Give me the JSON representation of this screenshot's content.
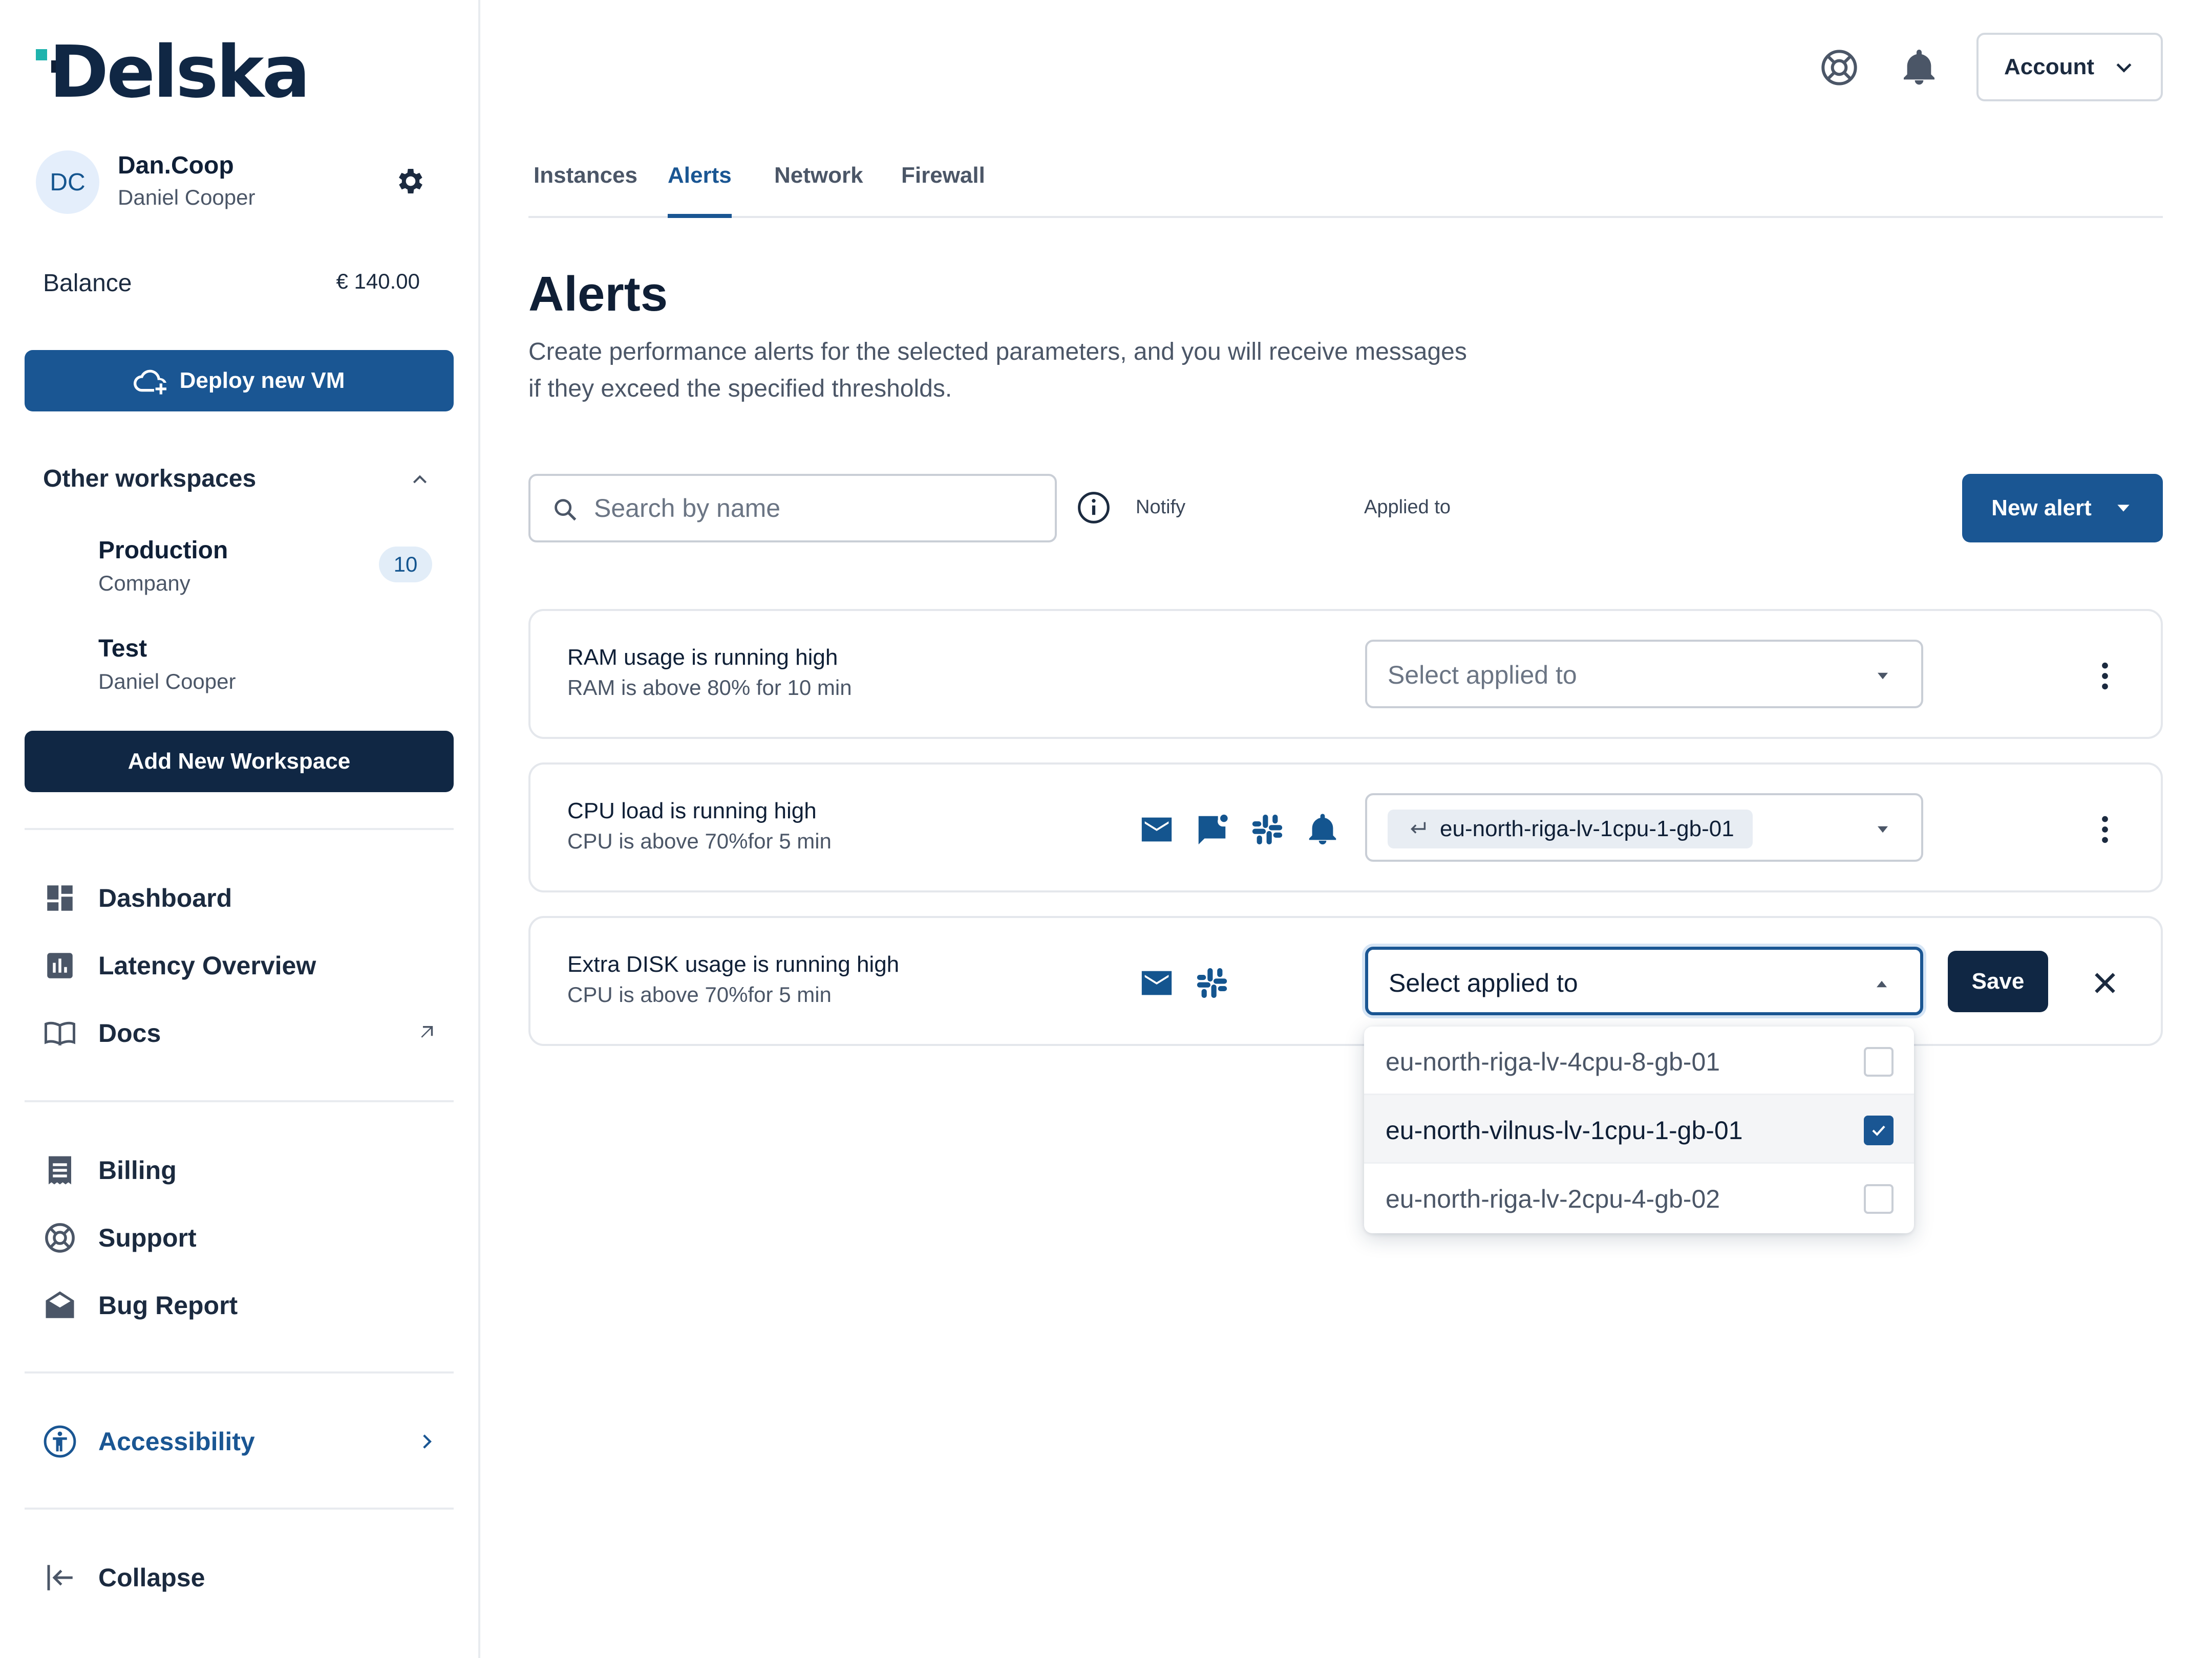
{
  "app": {
    "logo_text": "Delska"
  },
  "user": {
    "initials": "DC",
    "username": "Dan.Coop",
    "full_name": "Daniel Cooper"
  },
  "balance": {
    "label": "Balance",
    "value": "€ 140.00"
  },
  "sidebar": {
    "deploy_label": "Deploy new VM",
    "workspaces_heading": "Other workspaces",
    "workspaces": [
      {
        "name": "Production",
        "type": "Company",
        "badge": "10"
      },
      {
        "name": "Test",
        "type": "Daniel Cooper"
      }
    ],
    "add_workspace_label": "Add New Workspace",
    "nav_main": [
      {
        "label": "Dashboard",
        "icon": "dashboard-icon"
      },
      {
        "label": "Latency Overview",
        "icon": "bar-chart-icon"
      },
      {
        "label": "Docs",
        "icon": "book-icon"
      }
    ],
    "nav_secondary": [
      {
        "label": "Billing",
        "icon": "receipt-icon"
      },
      {
        "label": "Support",
        "icon": "lifebuoy-icon"
      },
      {
        "label": "Bug Report",
        "icon": "mail-open-icon"
      }
    ],
    "accessibility_label": "Accessibility",
    "collapse_label": "Collapse"
  },
  "header": {
    "account_label": "Account"
  },
  "tabs": [
    {
      "label": "Instances",
      "active": false
    },
    {
      "label": "Alerts",
      "active": true
    },
    {
      "label": "Network",
      "active": false
    },
    {
      "label": "Firewall",
      "active": false
    }
  ],
  "page": {
    "title": "Alerts",
    "description": "Create performance alerts for the selected parameters, and you will receive messages if they exceed the specified thresholds."
  },
  "filters": {
    "search_placeholder": "Search by name",
    "notify_label": "Notify",
    "applied_to_label": "Applied to",
    "new_alert_label": "New alert"
  },
  "alerts": [
    {
      "title": "RAM usage is running high",
      "condition": "RAM is above 80% for 10 min",
      "notify": [],
      "applied_placeholder": "Select applied to"
    },
    {
      "title": "CPU load is running high",
      "condition": "CPU is above 70%for 5 min",
      "notify": [
        "email-icon",
        "chat-icon",
        "slack-icon",
        "bell-icon"
      ],
      "applied_chip": "eu-north-riga-lv-1cpu-1-gb-01"
    },
    {
      "title": "Extra DISK usage is running high",
      "condition": "CPU is above 70%for 5 min",
      "notify": [
        "email-icon",
        "slack-icon"
      ],
      "applied_placeholder": "Select applied to",
      "save_label": "Save"
    }
  ],
  "dropdown": {
    "options": [
      {
        "label": "eu-north-riga-lv-4cpu-8-gb-01",
        "checked": false
      },
      {
        "label": "eu-north-vilnus-lv-1cpu-1-gb-01",
        "checked": true
      },
      {
        "label": "eu-north-riga-lv-2cpu-4-gb-02",
        "checked": false
      }
    ]
  },
  "colors": {
    "primary": "#1a5693",
    "navy": "#102744",
    "teal": "#1fb3ad",
    "text": "#0f1f36",
    "muted": "#4b5667"
  }
}
